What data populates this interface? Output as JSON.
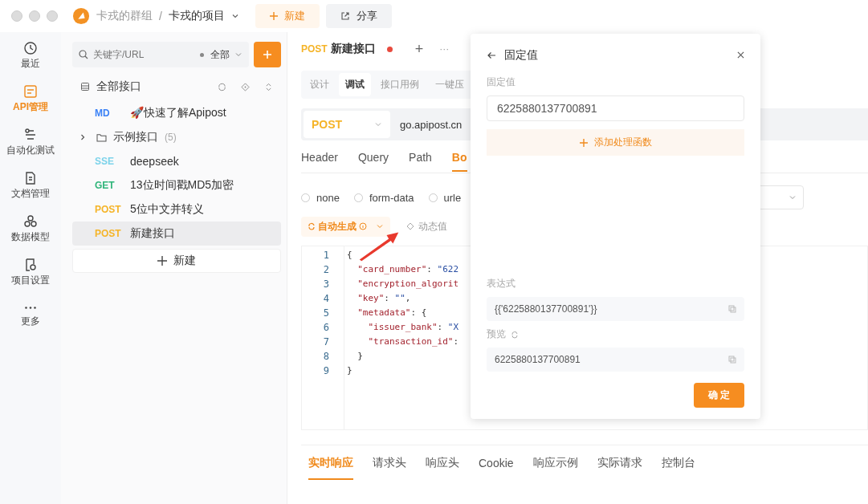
{
  "titlebar": {
    "group": "卡戎的群组",
    "separator": "/",
    "project": "卡戎的项目",
    "new_button": "新建",
    "share_button": "分享"
  },
  "nav": [
    {
      "label": "最近",
      "selected": false
    },
    {
      "label": "API管理",
      "selected": true
    },
    {
      "label": "自动化测试",
      "selected": false
    },
    {
      "label": "文档管理",
      "selected": false
    },
    {
      "label": "数据模型",
      "selected": false
    },
    {
      "label": "项目设置",
      "selected": false
    },
    {
      "label": "更多",
      "selected": false
    }
  ],
  "sidebar": {
    "search": {
      "placeholder": "关键字/URL"
    },
    "filter": "全部",
    "root": "全部接口",
    "items": [
      {
        "kind": "api",
        "method": "MD",
        "color": "#3b82f6",
        "name": "🚀快速了解Apipost",
        "selected": false
      },
      {
        "kind": "folder",
        "name": "示例接口",
        "count": "(5)",
        "expanded": false
      },
      {
        "kind": "api",
        "method": "SSE",
        "color": "#7dd3ea",
        "name": "deepseek",
        "selected": false
      },
      {
        "kind": "api",
        "method": "GET",
        "color": "#2fb57a",
        "name": "13位时间戳MD5加密",
        "selected": false
      },
      {
        "kind": "api",
        "method": "POST",
        "color": "#f5b428",
        "name": "5位中文并转义",
        "selected": false
      },
      {
        "kind": "api",
        "method": "POST",
        "color": "#f5b428",
        "name": "新建接口",
        "selected": true
      }
    ],
    "new_button": "新建"
  },
  "tab": {
    "method": "POST",
    "title": "新建接口",
    "unsaved": true,
    "add": "+",
    "more": "···"
  },
  "mode_tabs": [
    {
      "label": "设计",
      "selected": false
    },
    {
      "label": "调试",
      "selected": true
    },
    {
      "label": "接口用例",
      "selected": false
    },
    {
      "label": "一键压",
      "selected": false
    }
  ],
  "request": {
    "method": "POST",
    "url": "go.apipost.cn"
  },
  "param_tabs": [
    {
      "label": "Header",
      "selected": false
    },
    {
      "label": "Query",
      "selected": false
    },
    {
      "label": "Path",
      "selected": false
    },
    {
      "label": "Bo",
      "selected": true
    }
  ],
  "body_types": [
    {
      "label": "none",
      "selected": false
    },
    {
      "label": "form-data",
      "selected": false
    },
    {
      "label": "urle",
      "selected": false
    }
  ],
  "toolbar": {
    "auto_generate": "自动生成",
    "dynamic_value": "动态值"
  },
  "code": [
    {
      "number": "1",
      "tokens": [
        {
          "kind": "punct",
          "text": "{"
        }
      ]
    },
    {
      "number": "2",
      "tokens": [
        {
          "kind": "key",
          "text": "  \"card_number\""
        },
        {
          "kind": "punct",
          "text": ": "
        },
        {
          "kind": "string",
          "text": "\"622"
        }
      ]
    },
    {
      "number": "3",
      "tokens": [
        {
          "kind": "key",
          "text": "  \"encryption_algorit"
        }
      ]
    },
    {
      "number": "4",
      "tokens": [
        {
          "kind": "key",
          "text": "  \"key\""
        },
        {
          "kind": "punct",
          "text": ": "
        },
        {
          "kind": "string",
          "text": "\"\""
        },
        {
          "kind": "punct",
          "text": ","
        }
      ]
    },
    {
      "number": "5",
      "tokens": [
        {
          "kind": "key",
          "text": "  \"metadata\""
        },
        {
          "kind": "punct",
          "text": ": {"
        }
      ]
    },
    {
      "number": "6",
      "tokens": [
        {
          "kind": "key",
          "text": "    \"issuer_bank\""
        },
        {
          "kind": "punct",
          "text": ": "
        },
        {
          "kind": "string",
          "text": "\"X"
        }
      ]
    },
    {
      "number": "7",
      "tokens": [
        {
          "kind": "key",
          "text": "    \"transaction_id\""
        },
        {
          "kind": "punct",
          "text": ":"
        }
      ]
    },
    {
      "number": "8",
      "tokens": [
        {
          "kind": "punct",
          "text": "  }"
        }
      ]
    },
    {
      "number": "9",
      "tokens": [
        {
          "kind": "punct",
          "text": "}"
        }
      ]
    }
  ],
  "response_tabs": [
    {
      "label": "实时响应",
      "selected": true
    },
    {
      "label": "请求头",
      "selected": false
    },
    {
      "label": "响应头",
      "selected": false
    },
    {
      "label": "Cookie",
      "selected": false
    },
    {
      "label": "响应示例",
      "selected": false
    },
    {
      "label": "实际请求",
      "selected": false
    },
    {
      "label": "控制台",
      "selected": false
    }
  ],
  "popup": {
    "title": "固定值",
    "value_label": "固定值",
    "value": "6225880137700891",
    "add_function": "添加处理函数",
    "expression_label": "表达式",
    "expression": "{{'6225880137700891'}}",
    "preview_label": "预览",
    "preview": "6225880137700891",
    "confirm": "确 定"
  }
}
